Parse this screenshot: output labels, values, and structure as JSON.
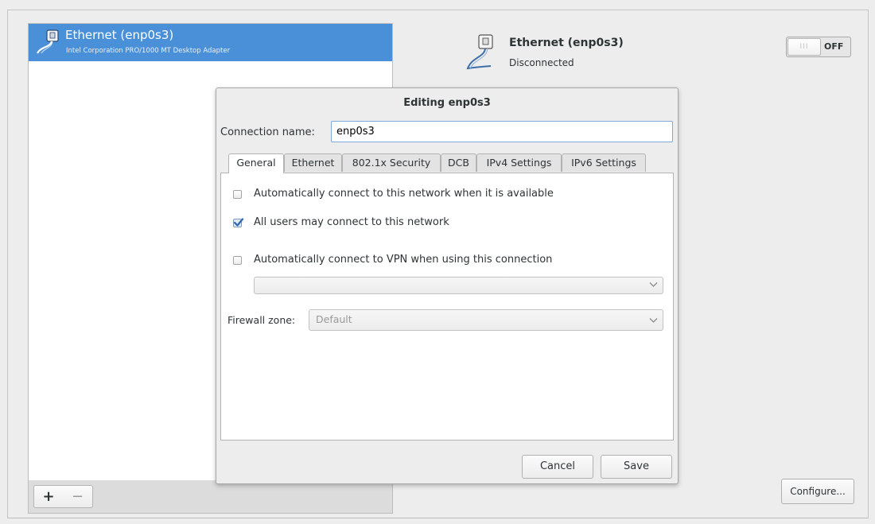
{
  "device_list": {
    "items": [
      {
        "name": "Ethernet (enp0s3)",
        "description": "Intel Corporation PRO/1000 MT Desktop Adapter",
        "icon": "ethernet-icon"
      }
    ],
    "add_label": "+",
    "remove_label": "−"
  },
  "details": {
    "title": "Ethernet (enp0s3)",
    "status": "Disconnected",
    "toggle_state": "OFF",
    "toggle_knob": "III",
    "configure_label": "Configure..."
  },
  "dialog": {
    "title": "Editing enp0s3",
    "connection_name_label": "Connection name:",
    "connection_name_value": "enp0s3",
    "tabs": [
      "General",
      "Ethernet",
      "802.1x Security",
      "DCB",
      "IPv4 Settings",
      "IPv6 Settings"
    ],
    "active_tab": "General",
    "general": {
      "auto_connect_label": "Automatically connect to this network when it is available",
      "auto_connect_checked": false,
      "all_users_label": "All users may connect to this network",
      "all_users_checked": true,
      "auto_vpn_label": "Automatically connect to VPN when using this connection",
      "auto_vpn_checked": false,
      "vpn_selected": "",
      "firewall_zone_label": "Firewall zone:",
      "firewall_zone_value": "Default"
    },
    "cancel_label": "Cancel",
    "save_label": "Save"
  },
  "colors": {
    "selection": "#4a90d9",
    "background": "#ededed",
    "focus_border": "#7ea9d8"
  }
}
